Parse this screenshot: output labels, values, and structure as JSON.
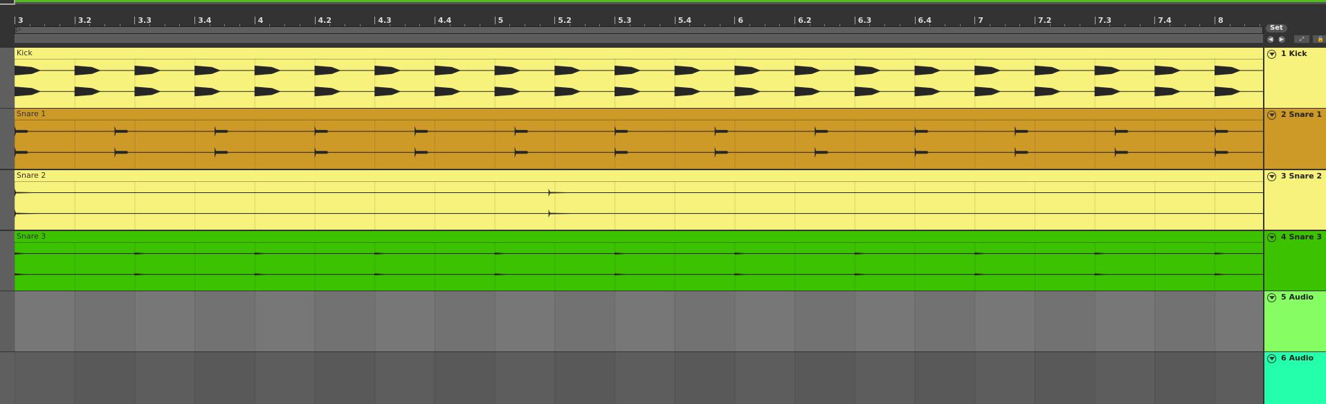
{
  "ruler": {
    "labels": [
      "3",
      "3.2",
      "3.3",
      "3.4",
      "4",
      "4.2",
      "4.3",
      "4.4",
      "5",
      "5.2",
      "5.3",
      "5.4",
      "6",
      "6.2",
      "6.3",
      "6.4",
      "7",
      "7.2",
      "7.3",
      "7.4",
      "8"
    ]
  },
  "controls": {
    "set_label": "Set",
    "back_icon": "arrow-left-icon",
    "forward_icon": "arrow-right-icon",
    "expand_icon": "expand-icon",
    "lock_icon": "lock-icon"
  },
  "tracks": [
    {
      "clip": "Kick",
      "header": "1 Kick",
      "color": "#f6f27b",
      "header_color": "#f6f27b"
    },
    {
      "clip": "Snare 1",
      "header": "2 Snare 1",
      "color": "#cd9a28",
      "header_color": "#cd9a28"
    },
    {
      "clip": "Snare 2",
      "header": "3 Snare 2",
      "color": "#f6f27b",
      "header_color": "#f6f27b"
    },
    {
      "clip": "Snare 3",
      "header": "4 Snare 3",
      "color": "#3dc200",
      "header_color": "#3dc200"
    },
    {
      "clip": null,
      "header": "5 Audio",
      "color": "#777777",
      "header_color": "#86fd63"
    },
    {
      "clip": null,
      "header": "6 Audio",
      "color": "#5d5d5d",
      "header_color": "#23ffaa"
    }
  ]
}
